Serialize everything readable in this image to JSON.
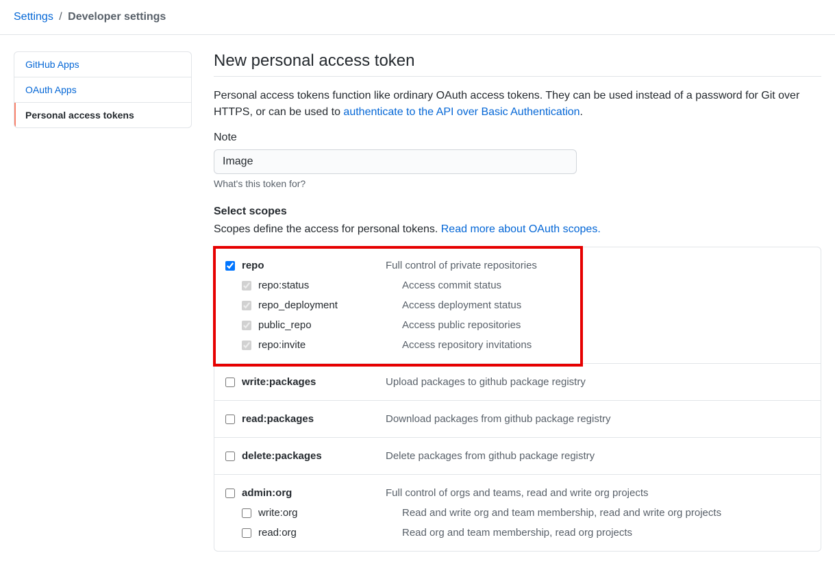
{
  "breadcrumb": {
    "root": "Settings",
    "sep": "/",
    "current": "Developer settings"
  },
  "sidebar": {
    "items": [
      {
        "label": "GitHub Apps",
        "selected": false
      },
      {
        "label": "OAuth Apps",
        "selected": false
      },
      {
        "label": "Personal access tokens",
        "selected": true
      }
    ]
  },
  "main": {
    "heading": "New personal access token",
    "description_pre": "Personal access tokens function like ordinary OAuth access tokens. They can be used instead of a password for Git over HTTPS, or can be used to ",
    "description_link": "authenticate to the API over Basic Authentication",
    "description_post": ".",
    "note": {
      "label": "Note",
      "value": "Image",
      "help": "What's this token for?"
    },
    "scopes": {
      "heading": "Select scopes",
      "sub_pre": "Scopes define the access for personal tokens. ",
      "sub_link": "Read more about OAuth scopes.",
      "groups": [
        {
          "parent": {
            "name": "repo",
            "desc": "Full control of private repositories",
            "checked": true
          },
          "children": [
            {
              "name": "repo:status",
              "desc": "Access commit status",
              "checked": true,
              "disabled": true
            },
            {
              "name": "repo_deployment",
              "desc": "Access deployment status",
              "checked": true,
              "disabled": true
            },
            {
              "name": "public_repo",
              "desc": "Access public repositories",
              "checked": true,
              "disabled": true
            },
            {
              "name": "repo:invite",
              "desc": "Access repository invitations",
              "checked": true,
              "disabled": true
            }
          ],
          "highlighted": true
        },
        {
          "parent": {
            "name": "write:packages",
            "desc": "Upload packages to github package registry",
            "checked": false
          },
          "children": []
        },
        {
          "parent": {
            "name": "read:packages",
            "desc": "Download packages from github package registry",
            "checked": false
          },
          "children": []
        },
        {
          "parent": {
            "name": "delete:packages",
            "desc": "Delete packages from github package registry",
            "checked": false
          },
          "children": []
        },
        {
          "parent": {
            "name": "admin:org",
            "desc": "Full control of orgs and teams, read and write org projects",
            "checked": false
          },
          "children": [
            {
              "name": "write:org",
              "desc": "Read and write org and team membership, read and write org projects",
              "checked": false
            },
            {
              "name": "read:org",
              "desc": "Read org and team membership, read org projects",
              "checked": false
            }
          ]
        }
      ]
    }
  }
}
